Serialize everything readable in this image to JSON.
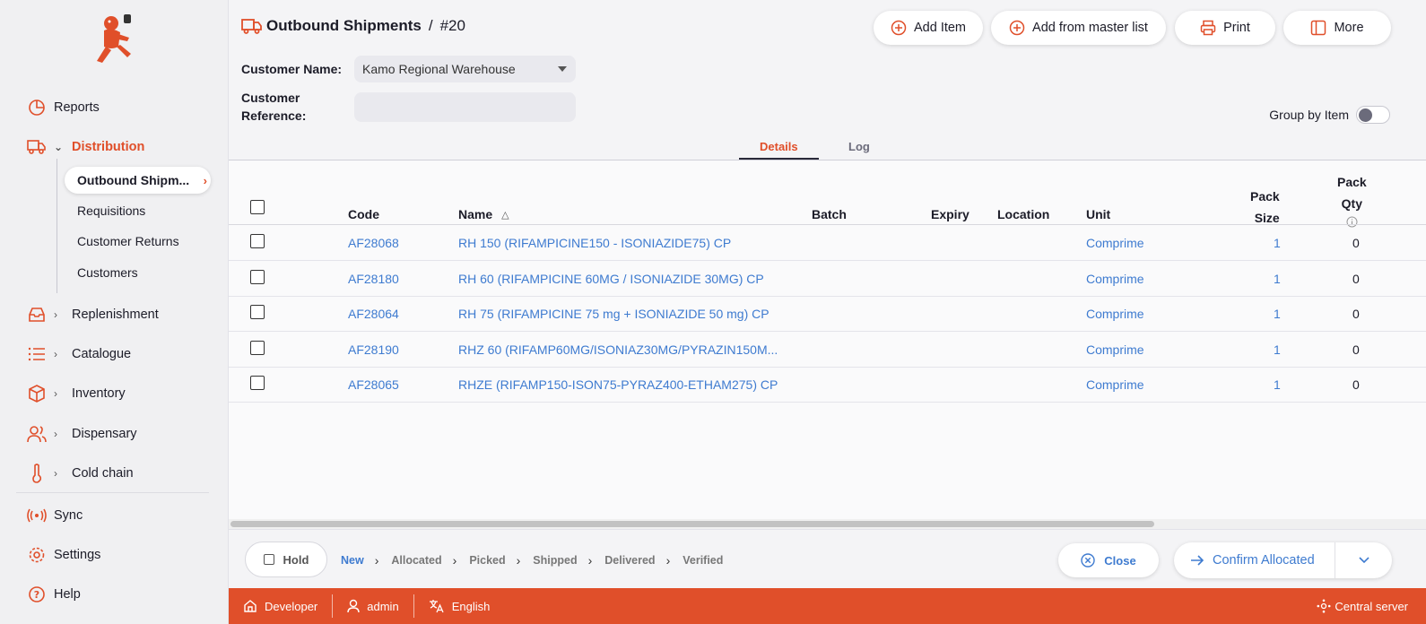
{
  "sidebar": {
    "items": [
      {
        "label": "Reports"
      },
      {
        "label": "Distribution"
      },
      {
        "label": "Replenishment"
      },
      {
        "label": "Catalogue"
      },
      {
        "label": "Inventory"
      },
      {
        "label": "Dispensary"
      },
      {
        "label": "Cold chain"
      },
      {
        "label": "Sync"
      },
      {
        "label": "Settings"
      },
      {
        "label": "Help"
      }
    ],
    "sub_items": [
      {
        "label": "Outbound Shipm..."
      },
      {
        "label": "Requisitions"
      },
      {
        "label": "Customer Returns"
      },
      {
        "label": "Customers"
      }
    ]
  },
  "header": {
    "title": "Outbound Shipments",
    "separator": "/",
    "number": "#20",
    "buttons": {
      "add_item": "Add Item",
      "add_master": "Add from master list",
      "print": "Print",
      "more": "More"
    },
    "customer_name_label": "Customer Name:",
    "customer_name_value": "Kamo Regional Warehouse",
    "customer_ref_label_1": "Customer",
    "customer_ref_label_2": "Reference:",
    "customer_ref_value": "",
    "group_by_label": "Group by Item",
    "tabs": [
      {
        "label": "Details"
      },
      {
        "label": "Log"
      }
    ]
  },
  "table": {
    "columns": {
      "code": "Code",
      "name": "Name",
      "batch": "Batch",
      "expiry": "Expiry",
      "location": "Location",
      "unit": "Unit",
      "pack_size_1": "Pack",
      "pack_size_2": "Size",
      "pack_qty_1": "Pack",
      "pack_qty_2": "Qty"
    },
    "rows": [
      {
        "code": "AF28068",
        "name": "RH 150 (RIFAMPICINE150 - ISONIAZIDE75) CP",
        "unit": "Comprime",
        "pack_size": "1",
        "pack_qty": "0"
      },
      {
        "code": "AF28180",
        "name": "RH 60 (RIFAMPICINE 60MG / ISONIAZIDE 30MG) CP",
        "unit": "Comprime",
        "pack_size": "1",
        "pack_qty": "0"
      },
      {
        "code": "AF28064",
        "name": "RH 75 (RIFAMPICINE 75 mg + ISONIAZIDE 50 mg) CP",
        "unit": "Comprime",
        "pack_size": "1",
        "pack_qty": "0"
      },
      {
        "code": "AF28190",
        "name": "RHZ 60 (RIFAMP60MG/ISONIAZ30MG/PYRAZIN150M...",
        "unit": "Comprime",
        "pack_size": "1",
        "pack_qty": "0"
      },
      {
        "code": "AF28065",
        "name": "RHZE (RIFAMP150-ISON75-PYRAZ400-ETHAM275) CP",
        "unit": "Comprime",
        "pack_size": "1",
        "pack_qty": "0"
      }
    ]
  },
  "footer": {
    "hold_label": "Hold",
    "steps": [
      "New",
      "Allocated",
      "Picked",
      "Shipped",
      "Delivered",
      "Verified"
    ],
    "close_label": "Close",
    "confirm_label": "Confirm Allocated"
  },
  "statusbar": {
    "site": "Developer",
    "user": "admin",
    "language": "English",
    "server": "Central server"
  },
  "colors": {
    "accent": "#e04f2a",
    "link": "#3e7bd0"
  }
}
